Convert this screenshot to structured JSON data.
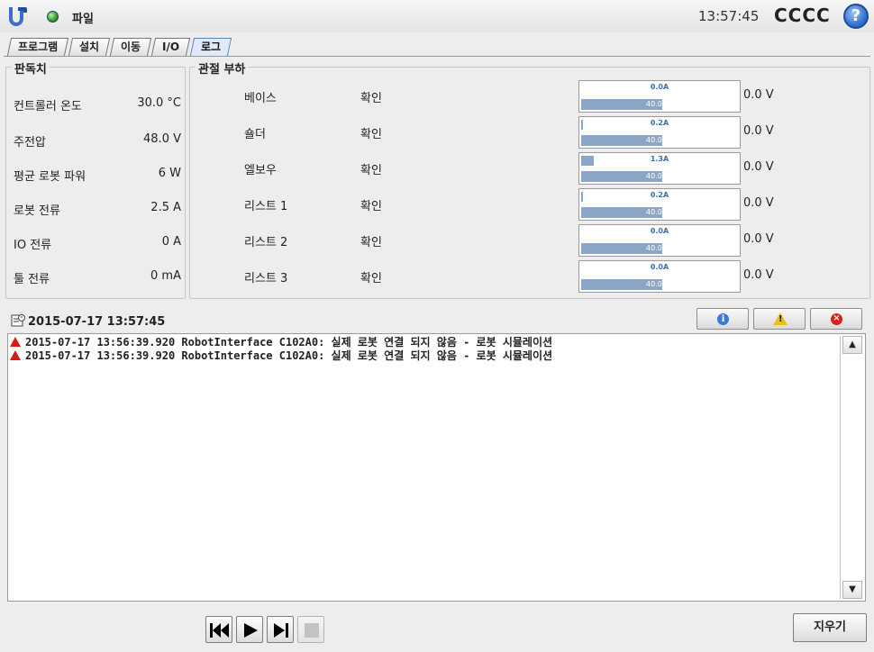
{
  "titlebar": {
    "file_label": "파일",
    "clock": "13:57:45",
    "robot_name": "CCCC",
    "help_glyph": "?"
  },
  "tabs": [
    {
      "label": "프로그램",
      "active": false
    },
    {
      "label": "설치",
      "active": false
    },
    {
      "label": "이동",
      "active": false
    },
    {
      "label": "I/O",
      "active": false
    },
    {
      "label": "로그",
      "active": true
    }
  ],
  "readings": {
    "title": "판독치",
    "rows": [
      {
        "label": "컨트롤러 온도",
        "value": "30.0 °C"
      },
      {
        "label": "주전압",
        "value": "48.0  V"
      },
      {
        "label": "평균 로봇 파워",
        "value": "6  W"
      },
      {
        "label": "로봇 전류",
        "value": "2.5  A"
      },
      {
        "label": "IO 전류",
        "value": "0  A"
      },
      {
        "label": "툴 전류",
        "value": "0 mA"
      }
    ]
  },
  "joint_load": {
    "title": "관절 부하",
    "rows": [
      {
        "name": "베이스",
        "status": "확인",
        "current": "0.0A",
        "current_fraction": 0.0,
        "temp": "40.0 °C",
        "voltage": "0.0 V"
      },
      {
        "name": "숄더",
        "status": "확인",
        "current": "0.2A",
        "current_fraction": 0.01,
        "temp": "40.0 °C",
        "voltage": "0.0 V"
      },
      {
        "name": "엘보우",
        "status": "확인",
        "current": "1.3A",
        "current_fraction": 0.08,
        "temp": "40.0 °C",
        "voltage": "0.0 V"
      },
      {
        "name": "리스트 1",
        "status": "확인",
        "current": "0.2A",
        "current_fraction": 0.01,
        "temp": "40.0 °C",
        "voltage": "0.0 V"
      },
      {
        "name": "리스트 2",
        "status": "확인",
        "current": "0.0A",
        "current_fraction": 0.0,
        "temp": "40.0 °C",
        "voltage": "0.0 V"
      },
      {
        "name": "리스트 3",
        "status": "확인",
        "current": "0.0A",
        "current_fraction": 0.0,
        "temp": "40.0 °C",
        "voltage": "0.0 V"
      }
    ]
  },
  "log": {
    "header_date": "2015-07-17 13:57:45",
    "entries": [
      "2015-07-17 13:56:39.920 RobotInterface C102A0: 실제 로봇 연결 되지 않음 - 로봇 시뮬레이션",
      "2015-07-17 13:56:39.920 RobotInterface C102A0: 실제 로봇 연결 되지 않음 - 로봇 시뮬레이션"
    ],
    "filters": [
      "info-icon",
      "warning-icon",
      "error-icon"
    ]
  },
  "bottom": {
    "clear_label": "지우기"
  },
  "colors": {
    "bar": "#8aa7c8",
    "accent": "#3c6db0",
    "warning_red": "#d21d12"
  }
}
